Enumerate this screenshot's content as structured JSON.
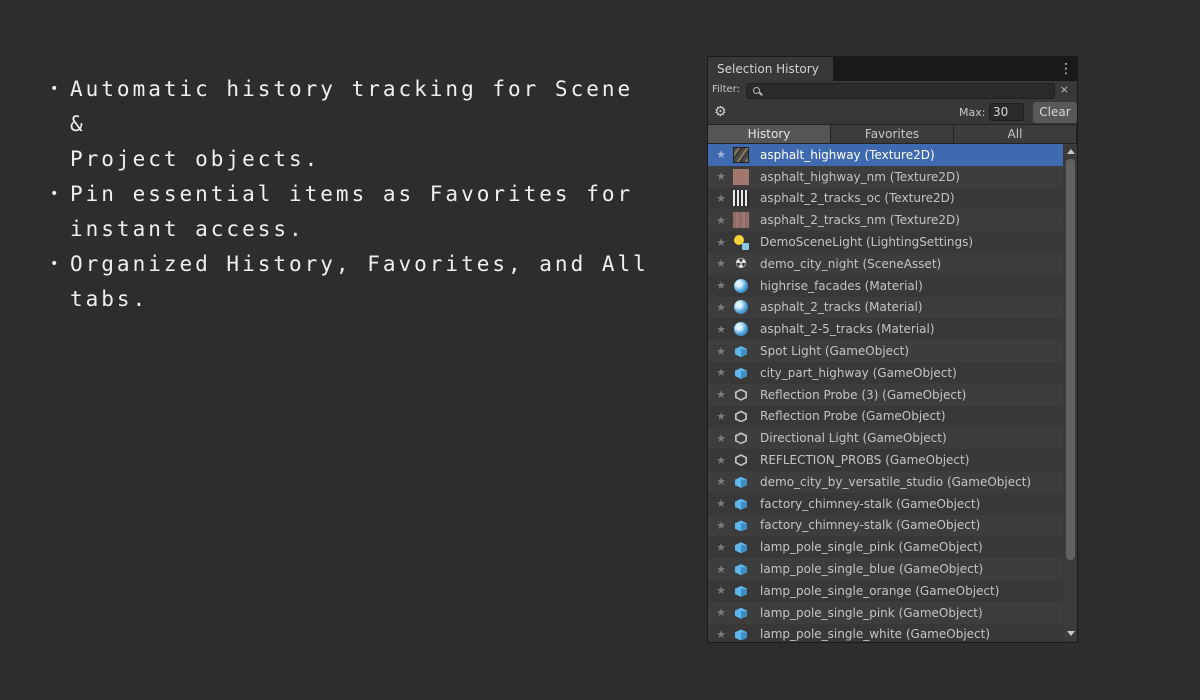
{
  "features": [
    {
      "line1": "Automatic history tracking for Scene &",
      "line2": "Project objects."
    },
    {
      "line1": "Pin essential items as Favorites for",
      "line2": "instant access."
    },
    {
      "line1": "Organized History, Favorites, and All",
      "line2": "tabs."
    }
  ],
  "panel": {
    "title": "Selection History",
    "menu_icon": "⋮",
    "filter_label": "Filter:",
    "filter_value": "",
    "filter_clear": "×",
    "max_label": "Max:",
    "max_value": "30",
    "clear_label": "Clear",
    "tabs": [
      "History",
      "Favorites",
      "All"
    ],
    "active_tab": "History",
    "items": [
      {
        "name": "asphalt_highway (Texture2D)",
        "icon": "texture-road-icon",
        "selected": true
      },
      {
        "name": "asphalt_highway_nm (Texture2D)",
        "icon": "texture-pink-icon"
      },
      {
        "name": "asphalt_2_tracks_oc (Texture2D)",
        "icon": "texture-tracks-icon"
      },
      {
        "name": "asphalt_2_tracks_nm (Texture2D)",
        "icon": "texture-pink-striped-icon"
      },
      {
        "name": "DemoSceneLight (LightingSettings)",
        "icon": "lighting-settings-icon"
      },
      {
        "name": "demo_city_night (SceneAsset)",
        "icon": "scene-asset-icon"
      },
      {
        "name": "highrise_facades (Material)",
        "icon": "material-sphere-icon"
      },
      {
        "name": "asphalt_2_tracks (Material)",
        "icon": "material-sphere-icon"
      },
      {
        "name": "asphalt_2-5_tracks (Material)",
        "icon": "material-sphere-icon"
      },
      {
        "name": "Spot Light (GameObject)",
        "icon": "prefab-cube-icon"
      },
      {
        "name": "city_part_highway (GameObject)",
        "icon": "prefab-cube-icon"
      },
      {
        "name": "Reflection Probe (3) (GameObject)",
        "icon": "gameobject-outline-icon"
      },
      {
        "name": "Reflection Probe (GameObject)",
        "icon": "gameobject-outline-icon"
      },
      {
        "name": "Directional Light (GameObject)",
        "icon": "gameobject-outline-icon"
      },
      {
        "name": "REFLECTION_PROBS (GameObject)",
        "icon": "gameobject-outline-icon"
      },
      {
        "name": "demo_city_by_versatile_studio (GameObject)",
        "icon": "prefab-cube-icon"
      },
      {
        "name": "factory_chimney-stalk (GameObject)",
        "icon": "prefab-cube-icon"
      },
      {
        "name": "factory_chimney-stalk (GameObject)",
        "icon": "prefab-cube-icon"
      },
      {
        "name": "lamp_pole_single_pink (GameObject)",
        "icon": "prefab-cube-icon"
      },
      {
        "name": "lamp_pole_single_blue (GameObject)",
        "icon": "prefab-cube-icon"
      },
      {
        "name": "lamp_pole_single_orange (GameObject)",
        "icon": "prefab-cube-icon"
      },
      {
        "name": "lamp_pole_single_pink (GameObject)",
        "icon": "prefab-cube-icon"
      },
      {
        "name": "lamp_pole_single_white (GameObject)",
        "icon": "prefab-cube-icon"
      }
    ]
  }
}
